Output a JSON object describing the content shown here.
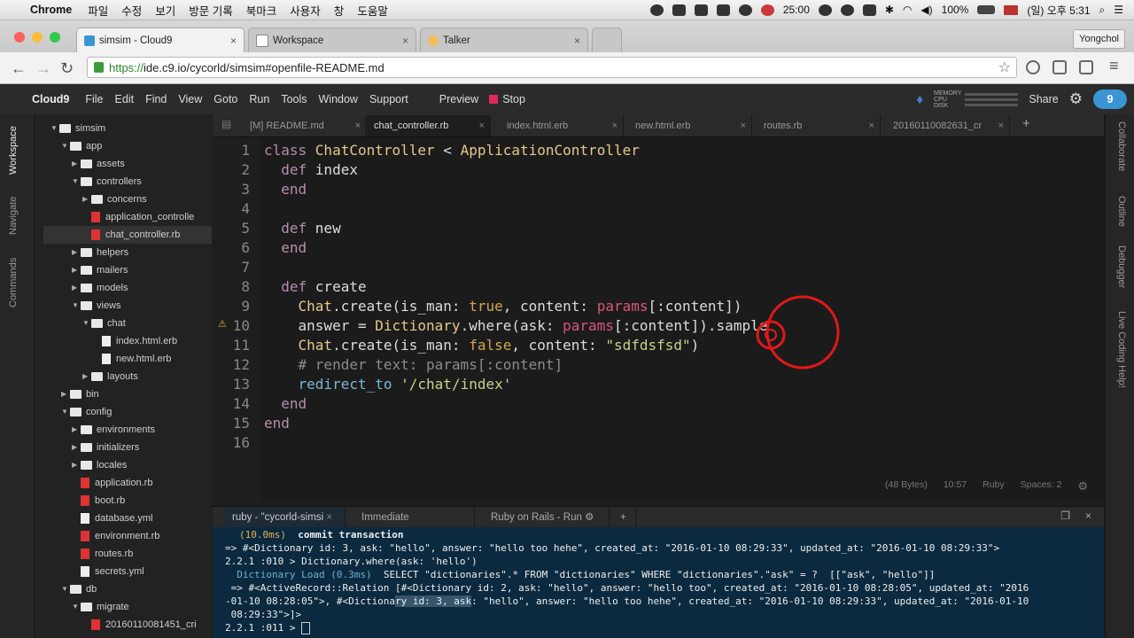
{
  "menubar": {
    "app": "Chrome",
    "items": [
      "파일",
      "수정",
      "보기",
      "방문 기록",
      "북마크",
      "사용자",
      "창",
      "도움말"
    ],
    "timer": "25:00",
    "battery": "100%",
    "clock": "(일) 오후 5:31"
  },
  "browser": {
    "tabs": [
      {
        "label": "simsim - Cloud9"
      },
      {
        "label": "Workspace"
      },
      {
        "label": "Talker"
      }
    ],
    "profile": "Yongchol",
    "url_scheme": "https://",
    "url_rest": "ide.c9.io/cycorld/simsim#openfile-README.md"
  },
  "c9": {
    "brand": "Cloud9",
    "menu": [
      "File",
      "Edit",
      "Find",
      "View",
      "Goto",
      "Run",
      "Tools",
      "Window",
      "Support"
    ],
    "preview": "Preview",
    "stop": "Stop",
    "share": "Share",
    "mem_labels": [
      "MEMORY",
      "CPU",
      "DISK"
    ],
    "logo": "9"
  },
  "left_tabs": [
    "Workspace",
    "Navigate",
    "Commands"
  ],
  "right_tabs": [
    "Collaborate",
    "Outline",
    "Debugger",
    "Live Coding Help!"
  ],
  "tree": [
    {
      "label": "simsim",
      "type": "folder",
      "depth": 0,
      "open": true
    },
    {
      "label": "app",
      "type": "folder",
      "depth": 1,
      "open": true
    },
    {
      "label": "assets",
      "type": "folder",
      "depth": 2,
      "open": false
    },
    {
      "label": "controllers",
      "type": "folder",
      "depth": 2,
      "open": true
    },
    {
      "label": "concerns",
      "type": "folder",
      "depth": 3,
      "open": false
    },
    {
      "label": "application_controlle",
      "type": "rb",
      "depth": 3
    },
    {
      "label": "chat_controller.rb",
      "type": "rb",
      "depth": 3,
      "selected": true
    },
    {
      "label": "helpers",
      "type": "folder",
      "depth": 2,
      "open": false
    },
    {
      "label": "mailers",
      "type": "folder",
      "depth": 2,
      "open": false
    },
    {
      "label": "models",
      "type": "folder",
      "depth": 2,
      "open": false
    },
    {
      "label": "views",
      "type": "folder",
      "depth": 2,
      "open": true
    },
    {
      "label": "chat",
      "type": "folder",
      "depth": 3,
      "open": true
    },
    {
      "label": "index.html.erb",
      "type": "file",
      "depth": 4
    },
    {
      "label": "new.html.erb",
      "type": "file",
      "depth": 4
    },
    {
      "label": "layouts",
      "type": "folder",
      "depth": 3,
      "open": false
    },
    {
      "label": "bin",
      "type": "folder",
      "depth": 1,
      "open": false
    },
    {
      "label": "config",
      "type": "folder",
      "depth": 1,
      "open": true
    },
    {
      "label": "environments",
      "type": "folder",
      "depth": 2,
      "open": false
    },
    {
      "label": "initializers",
      "type": "folder",
      "depth": 2,
      "open": false
    },
    {
      "label": "locales",
      "type": "folder",
      "depth": 2,
      "open": false
    },
    {
      "label": "application.rb",
      "type": "rb",
      "depth": 2
    },
    {
      "label": "boot.rb",
      "type": "rb",
      "depth": 2
    },
    {
      "label": "database.yml",
      "type": "file",
      "depth": 2
    },
    {
      "label": "environment.rb",
      "type": "rb",
      "depth": 2
    },
    {
      "label": "routes.rb",
      "type": "rb",
      "depth": 2
    },
    {
      "label": "secrets.yml",
      "type": "file",
      "depth": 2
    },
    {
      "label": "db",
      "type": "folder",
      "depth": 1,
      "open": true
    },
    {
      "label": "migrate",
      "type": "folder",
      "depth": 2,
      "open": true
    },
    {
      "label": "20160110081451_cri",
      "type": "rb",
      "depth": 3
    }
  ],
  "editor_tabs": [
    {
      "label": "[M] README.md"
    },
    {
      "label": "chat_controller.rb",
      "active": true
    },
    {
      "label": "index.html.erb"
    },
    {
      "label": "new.html.erb"
    },
    {
      "label": "routes.rb"
    },
    {
      "label": "20160110082631_cr"
    }
  ],
  "code_lines": [
    "1",
    "2",
    "3",
    "4",
    "5",
    "6",
    "7",
    "8",
    "9",
    "10",
    "11",
    "12",
    "13",
    "14",
    "15",
    "16"
  ],
  "code": {
    "l1a": "class ",
    "l1b": "ChatController",
    "l1c": " < ",
    "l1d": "ApplicationController",
    "l2a": "  def ",
    "l2b": "index",
    "l3": "  end",
    "l5a": "  def ",
    "l5b": "new",
    "l6": "  end",
    "l8a": "  def ",
    "l8b": "create",
    "l9a": "    ",
    "l9b": "Chat",
    "l9c": ".create(is_man: ",
    "l9d": "true",
    "l9e": ", content: ",
    "l9f": "params",
    "l9g": "[:content])",
    "l10a": "    answer = ",
    "l10b": "Dictionary",
    "l10c": ".where(ask: ",
    "l10d": "params",
    "l10e": "[:content]).sample",
    "l11a": "    ",
    "l11b": "Chat",
    "l11c": ".create(is_man: ",
    "l11d": "false",
    "l11e": ", content: ",
    "l11f": "\"sdfdsfsd\"",
    "l11g": ")",
    "l12": "    # render text: params[:content]",
    "l13a": "    ",
    "l13b": "redirect_to",
    "l13c": " ",
    "l13d": "'/chat/index'",
    "l14": "  end",
    "l15": "end"
  },
  "editor_status": {
    "bytes": "(48 Bytes)",
    "pos": "10:57",
    "lang": "Ruby",
    "spaces": "Spaces: 2"
  },
  "terminal_tabs": [
    {
      "label": "ruby - \"cycorld-simsi",
      "active": true
    },
    {
      "label": "Immediate"
    },
    {
      "label": "Ruby on Rails - Run"
    }
  ],
  "terminal": {
    "t1a": "(10.0ms)",
    "t1b": "  commit transaction",
    "t2": "=> #<Dictionary id: 3, ask: \"hello\", answer: \"hello too hehe\", created_at: \"2016-01-10 08:29:33\", updated_at: \"2016-01-10 08:29:33\">",
    "t3": "2.2.1 :010 > Dictionary.where(ask: 'hello')",
    "t4a": "  Dictionary Load (0.3ms)",
    "t4b": "  SELECT \"dictionaries\".* FROM \"dictionaries\" WHERE \"dictionaries\".\"ask\" = ?  [[\"ask\", \"hello\"]]",
    "t5": " => #<ActiveRecord::Relation [#<Dictionary id: 2, ask: \"hello\", answer: \"hello too\", created_at: \"2016-01-10 08:28:05\", updated_at: \"2016",
    "t6a": "-01-10 08:28:05\">, #<Dictiona",
    "t6b": "ry id: 3, ask",
    "t6c": ": \"hello\", answer: \"hello too hehe\", created_at: \"2016-01-10 08:29:33\", updated_at: \"2016-01-10",
    "t7": " 08:29:33\">]>",
    "t8": "2.2.1 :011 > "
  },
  "colors": {
    "accent": "#3a95d4",
    "stop": "#e0265f",
    "annotation": "#e01818"
  }
}
